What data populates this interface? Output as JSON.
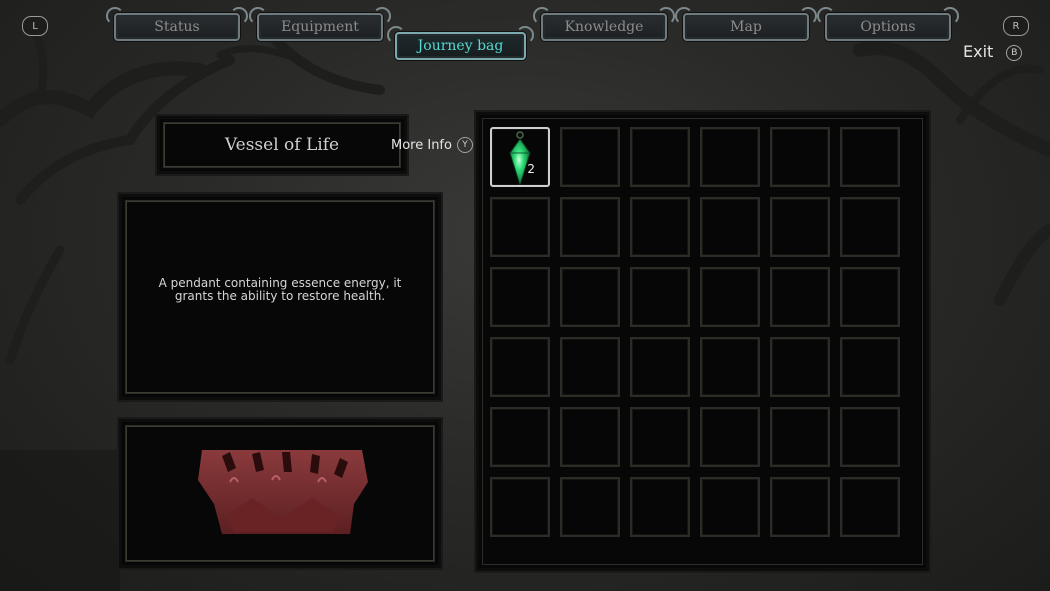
{
  "buttons": {
    "left_shoulder": "L",
    "right_shoulder": "R",
    "exit_key": "B",
    "more_info_key": "Y"
  },
  "tabs": [
    {
      "label": "Status",
      "active": false
    },
    {
      "label": "Equipment",
      "active": false
    },
    {
      "label": "Journey bag",
      "active": true
    },
    {
      "label": "Knowledge",
      "active": false
    },
    {
      "label": "Map",
      "active": false
    },
    {
      "label": "Options",
      "active": false
    }
  ],
  "exit_label": "Exit",
  "selected_item": {
    "name": "Vessel of Life",
    "description": "A pendant containing essence energy, it grants the ability to restore health.",
    "more_info_label": "More Info"
  },
  "inventory": {
    "rows": 6,
    "cols": 6,
    "slots": [
      {
        "icon": "green-pendant-icon",
        "count": "2",
        "selected": true
      }
    ]
  },
  "colors": {
    "accent": "#58d8d0",
    "gem": "#2fe07a"
  }
}
